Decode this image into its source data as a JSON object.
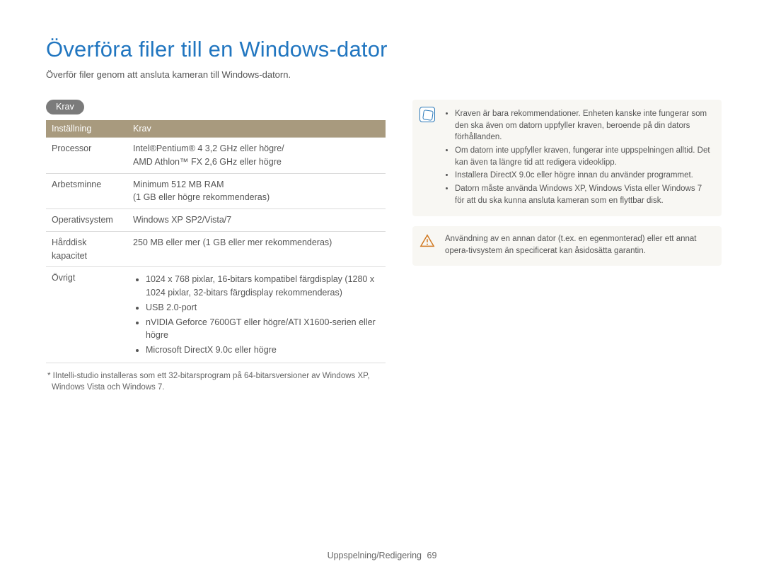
{
  "header": {
    "title": "Överföra filer till en Windows-dator",
    "subtitle": "Överför filer genom att ansluta kameran till Windows-datorn."
  },
  "section_label": "Krav",
  "table": {
    "headers": {
      "col1": "Inställning",
      "col2": "Krav"
    },
    "rows": {
      "processor": {
        "label": "Processor",
        "value_line1": "Intel®Pentium® 4 3,2 GHz eller högre/",
        "value_line2": "AMD Athlon™ FX 2,6 GHz eller högre"
      },
      "ram": {
        "label": "Arbetsminne",
        "value_line1": "Minimum 512 MB RAM",
        "value_line2": "(1 GB eller högre rekommenderas)"
      },
      "os": {
        "label": "Operativsystem",
        "value": "Windows XP SP2/Vista/7"
      },
      "hdd": {
        "label_line1": "Hårddisk",
        "label_line2": "kapacitet",
        "value": "250 MB eller mer (1 GB eller mer rekommenderas)"
      },
      "other": {
        "label": "Övrigt",
        "items": {
          "display": "1024 x 768 pixlar, 16-bitars kompatibel färgdisplay (1280 x 1024 pixlar, 32-bitars färgdisplay rekommenderas)",
          "usb": "USB 2.0-port",
          "gpu": "nVIDIA Geforce 7600GT eller högre/ATI X1600-serien eller högre",
          "directx": "Microsoft DirectX 9.0c eller högre"
        }
      }
    }
  },
  "footnote": "* IIntelli-studio installeras som ett 32-bitarsprogram på 64-bitarsversioner av Windows XP, Windows Vista och Windows 7.",
  "notes": {
    "info": {
      "items": {
        "a": "Kraven är bara rekommendationer. Enheten kanske inte fungerar som den ska även om datorn uppfyller kraven, beroende på din dators förhållanden.",
        "b": "Om datorn inte uppfyller kraven, fungerar inte uppspelningen alltid. Det kan även ta längre tid att redigera videoklipp.",
        "c": "Installera DirectX 9.0c eller högre innan du använder programmet.",
        "d": "Datorn måste använda Windows XP, Windows Vista eller Windows 7 för att du ska kunna ansluta kameran som en flyttbar disk."
      }
    },
    "warn": {
      "text": "Användning av en annan dator (t.ex. en egenmonterad) eller ett annat opera-tivsystem än specificerat kan åsidosätta garantin."
    }
  },
  "footer": {
    "section": "Uppspelning/Redigering",
    "page": "69"
  }
}
